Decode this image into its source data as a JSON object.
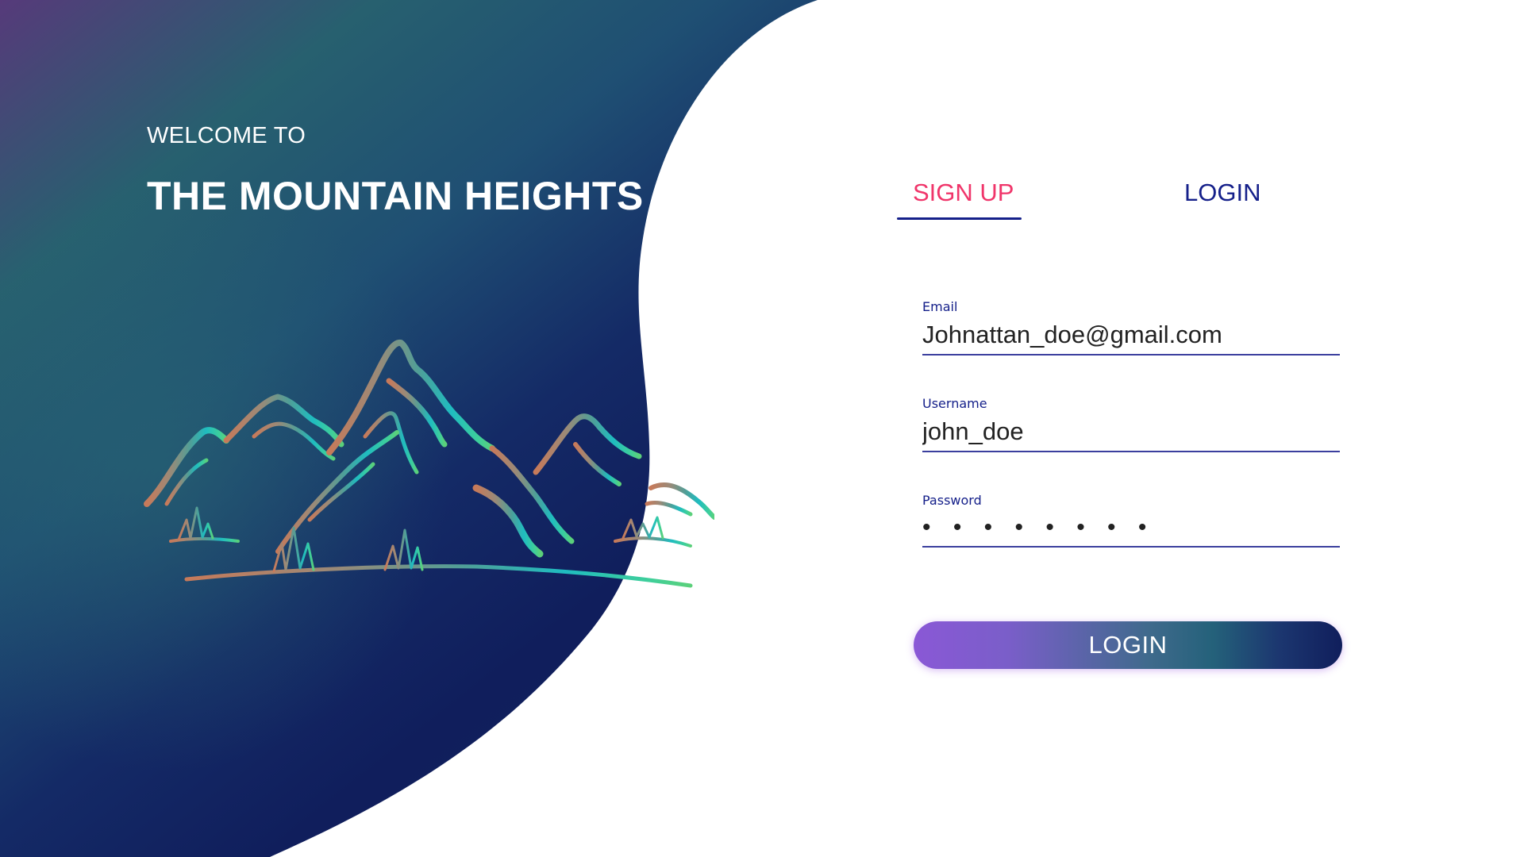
{
  "hero": {
    "welcome": "WELCOME TO",
    "brand": "THE MOUNTAIN HEIGHTS",
    "illustration_icon": "mountains-icon"
  },
  "tabs": {
    "signup": "SIGN UP",
    "login": "LOGIN",
    "active": "signup"
  },
  "form": {
    "email": {
      "label": "Email",
      "value": "Johnattan_doe@gmail.com"
    },
    "username": {
      "label": "Username",
      "value": "john_doe"
    },
    "password": {
      "label": "Password",
      "value": "• • • • • • • •"
    },
    "submit_label": "LOGIN"
  },
  "colors": {
    "accent_pink": "#f0356a",
    "accent_navy": "#15208a",
    "panel_dark": "#101e5c",
    "panel_teal": "#24617a",
    "panel_purple": "#5a3a8a",
    "button_start": "#8a58d6"
  }
}
